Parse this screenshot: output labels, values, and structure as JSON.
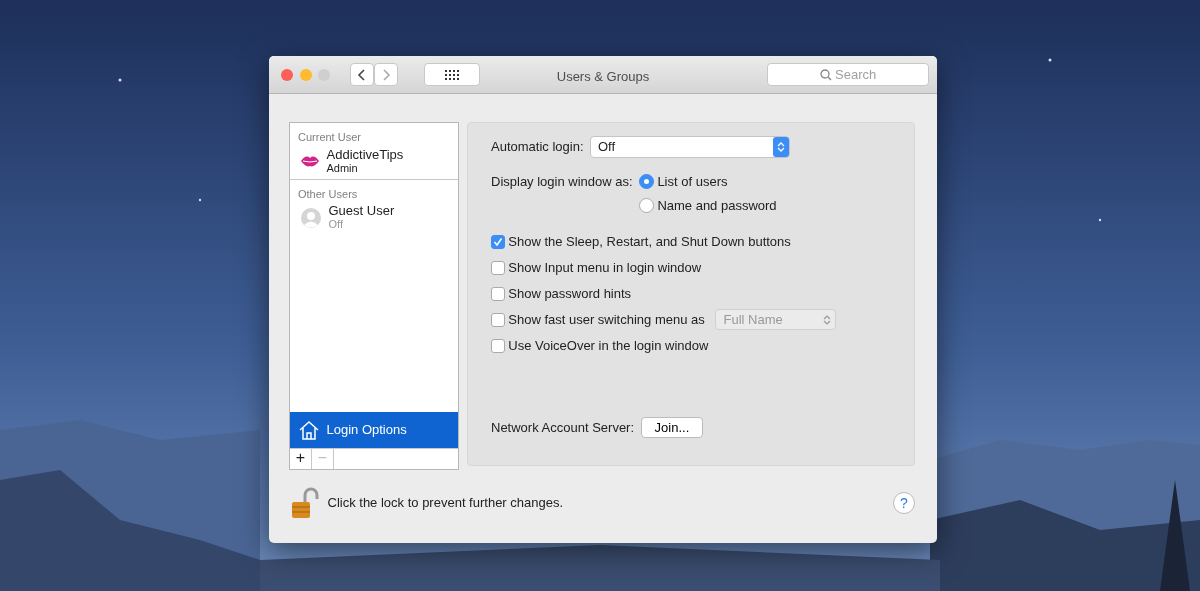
{
  "window": {
    "title": "Users & Groups"
  },
  "toolbar": {
    "search": {
      "placeholder": "Search"
    }
  },
  "sidebar": {
    "sections": [
      {
        "heading": "Current User",
        "users": [
          {
            "name": "AddictiveTips",
            "role": "Admin",
            "kind": "lips",
            "dimmed": false
          }
        ]
      },
      {
        "heading": "Other Users",
        "users": [
          {
            "name": "Guest User",
            "role": "Off",
            "kind": "person",
            "dimmed": true
          }
        ]
      }
    ],
    "login_options": {
      "label": "Login Options",
      "selected": true
    },
    "add": {
      "label": "+",
      "disabled": false
    },
    "remove": {
      "label": "−",
      "disabled": true
    }
  },
  "settings": {
    "automatic_login": {
      "label": "Automatic login:",
      "value": "Off"
    },
    "display_login": {
      "label": "Display login window as:",
      "options": [
        {
          "label": "List of users",
          "selected": true
        },
        {
          "label": "Name and password",
          "selected": false
        }
      ]
    },
    "checkboxes": [
      {
        "label": "Show the Sleep, Restart, and Shut Down buttons",
        "checked": true
      },
      {
        "label": "Show Input menu in login window",
        "checked": false
      },
      {
        "label": "Show password hints",
        "checked": false
      },
      {
        "label": "Show fast user switching menu as",
        "checked": false,
        "menu": {
          "value": "Full Name",
          "disabled": true
        }
      },
      {
        "label": "Use VoiceOver in the login window",
        "checked": false
      }
    ],
    "network": {
      "label": "Network Account Server:",
      "button": "Join..."
    }
  },
  "footer": {
    "lock_text": "Click the lock to prevent further changes.",
    "locked": false,
    "help": "?"
  }
}
